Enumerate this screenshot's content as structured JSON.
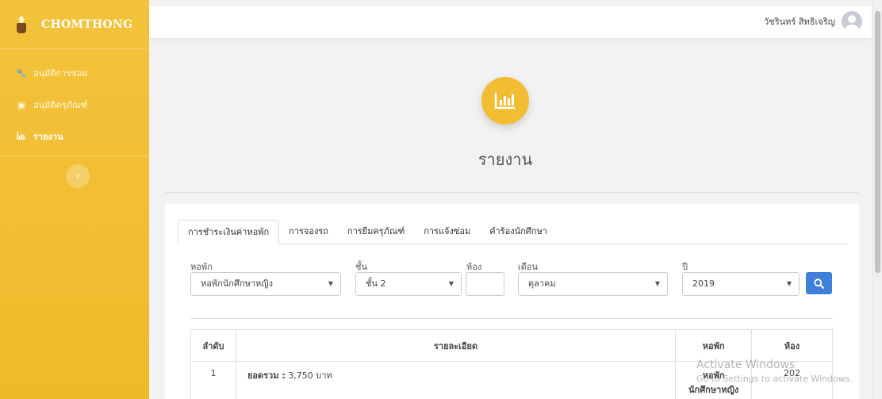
{
  "brand": {
    "name": "CHOMTHONG"
  },
  "sidebar": {
    "items": [
      {
        "label": "อนุมัติการซ่อม",
        "icon": "wrench-icon"
      },
      {
        "label": "อนุมัติครุภัณฑ์",
        "icon": "box-icon"
      },
      {
        "label": "รายงาน",
        "icon": "chart-icon",
        "active": true
      }
    ],
    "collapse_icon": "chevron-left-icon"
  },
  "topbar": {
    "username": "วัชรินทร์ สิทธิเจริญ",
    "avatar_icon": "user-avatar-icon"
  },
  "page": {
    "title": "รายงาน",
    "icon": "bar-chart-icon",
    "accent": "#f2bd33"
  },
  "tabs": [
    {
      "label": "การชำระเงินค่าหอพัก",
      "active": true
    },
    {
      "label": "การจองรถ"
    },
    {
      "label": "การยืมครุภัณฑ์"
    },
    {
      "label": "การแจ้งซ่อม"
    },
    {
      "label": "คำร้องนักศึกษา"
    }
  ],
  "filters": {
    "dorm": {
      "label": "หอพัก",
      "value": "หอพักนักศึกษาหญิง"
    },
    "floor": {
      "label": "ชั้น",
      "value": "ชั้น 2"
    },
    "room": {
      "label": "ห้อง",
      "value": ""
    },
    "month": {
      "label": "เดือน",
      "value": "ตุลาคม"
    },
    "year": {
      "label": "ปี",
      "value": "2019"
    },
    "search_icon": "search-icon",
    "button_color": "#3d7fd9"
  },
  "table": {
    "headers": [
      "ลำดับ",
      "รายละเอียด",
      "หอพัก",
      "ห้อง"
    ],
    "rows": [
      {
        "index": "1",
        "detail_label": "ยอดรวม :",
        "detail_value": "3,750 บาท",
        "dorm_line1": "หอพัก",
        "dorm_line2": "นักศึกษาหญิง",
        "room": "202"
      }
    ]
  },
  "watermark": {
    "title": "Activate Windows",
    "subtitle": "Go to Settings to activate Windows."
  }
}
